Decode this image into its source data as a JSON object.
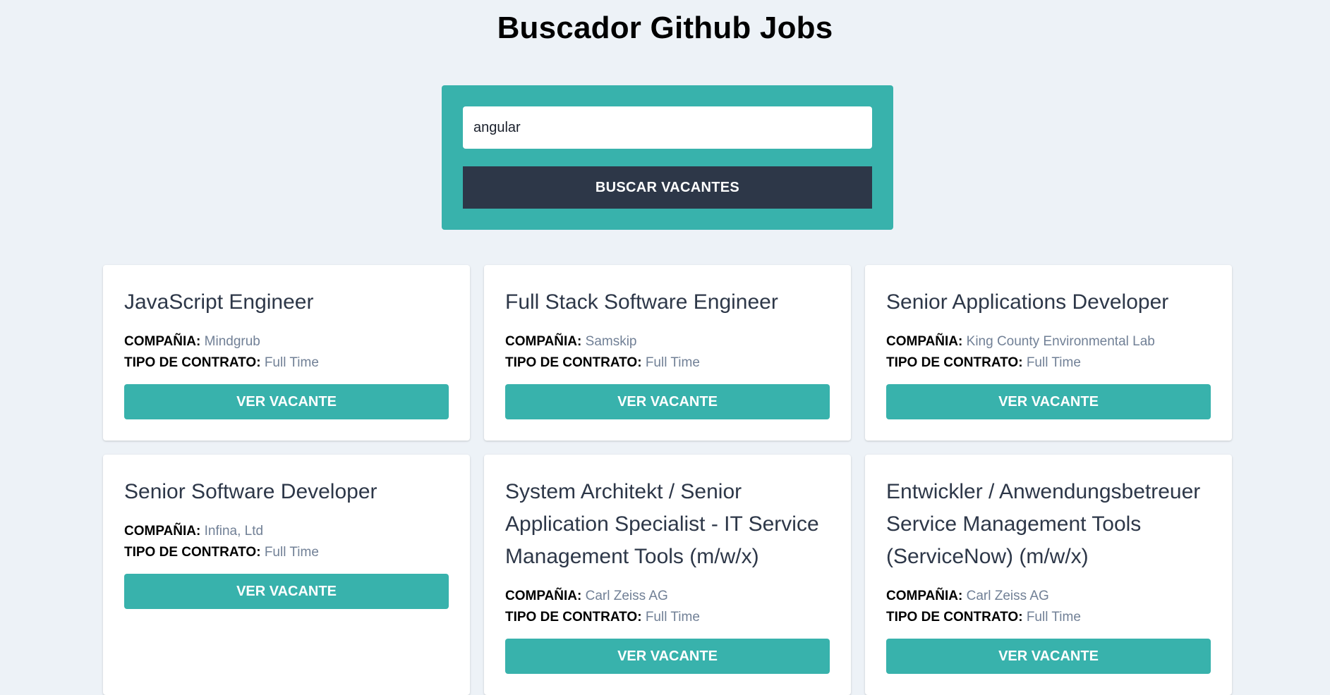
{
  "header": {
    "title": "Buscador Github Jobs"
  },
  "search": {
    "value": "angular",
    "button_label": "BUSCAR VACANTES"
  },
  "labels": {
    "company": "COMPAÑIA:",
    "contract_type": "TIPO DE CONTRATO:"
  },
  "jobs": [
    {
      "title": "JavaScript Engineer",
      "company": "Mindgrub",
      "contract_type": "Full Time",
      "button_label": "VER VACANTE"
    },
    {
      "title": "Full Stack Software Engineer",
      "company": "Samskip",
      "contract_type": "Full Time",
      "button_label": "VER VACANTE"
    },
    {
      "title": "Senior Applications Developer",
      "company": "King County Environmental Lab",
      "contract_type": "Full Time",
      "button_label": "VER VACANTE"
    },
    {
      "title": "Senior Software Developer",
      "company": "Infina, Ltd",
      "contract_type": "Full Time",
      "button_label": "VER VACANTE"
    },
    {
      "title": "System Architekt / Senior Application Specialist - IT Service Management Tools (m/w/x)",
      "company": "Carl Zeiss AG",
      "contract_type": "Full Time",
      "button_label": "VER VACANTE"
    },
    {
      "title": "Entwickler / Anwendungsbetreuer Service Management Tools (ServiceNow) (m/w/x)",
      "company": "Carl Zeiss AG",
      "contract_type": "Full Time",
      "button_label": "VER VACANTE"
    }
  ]
}
